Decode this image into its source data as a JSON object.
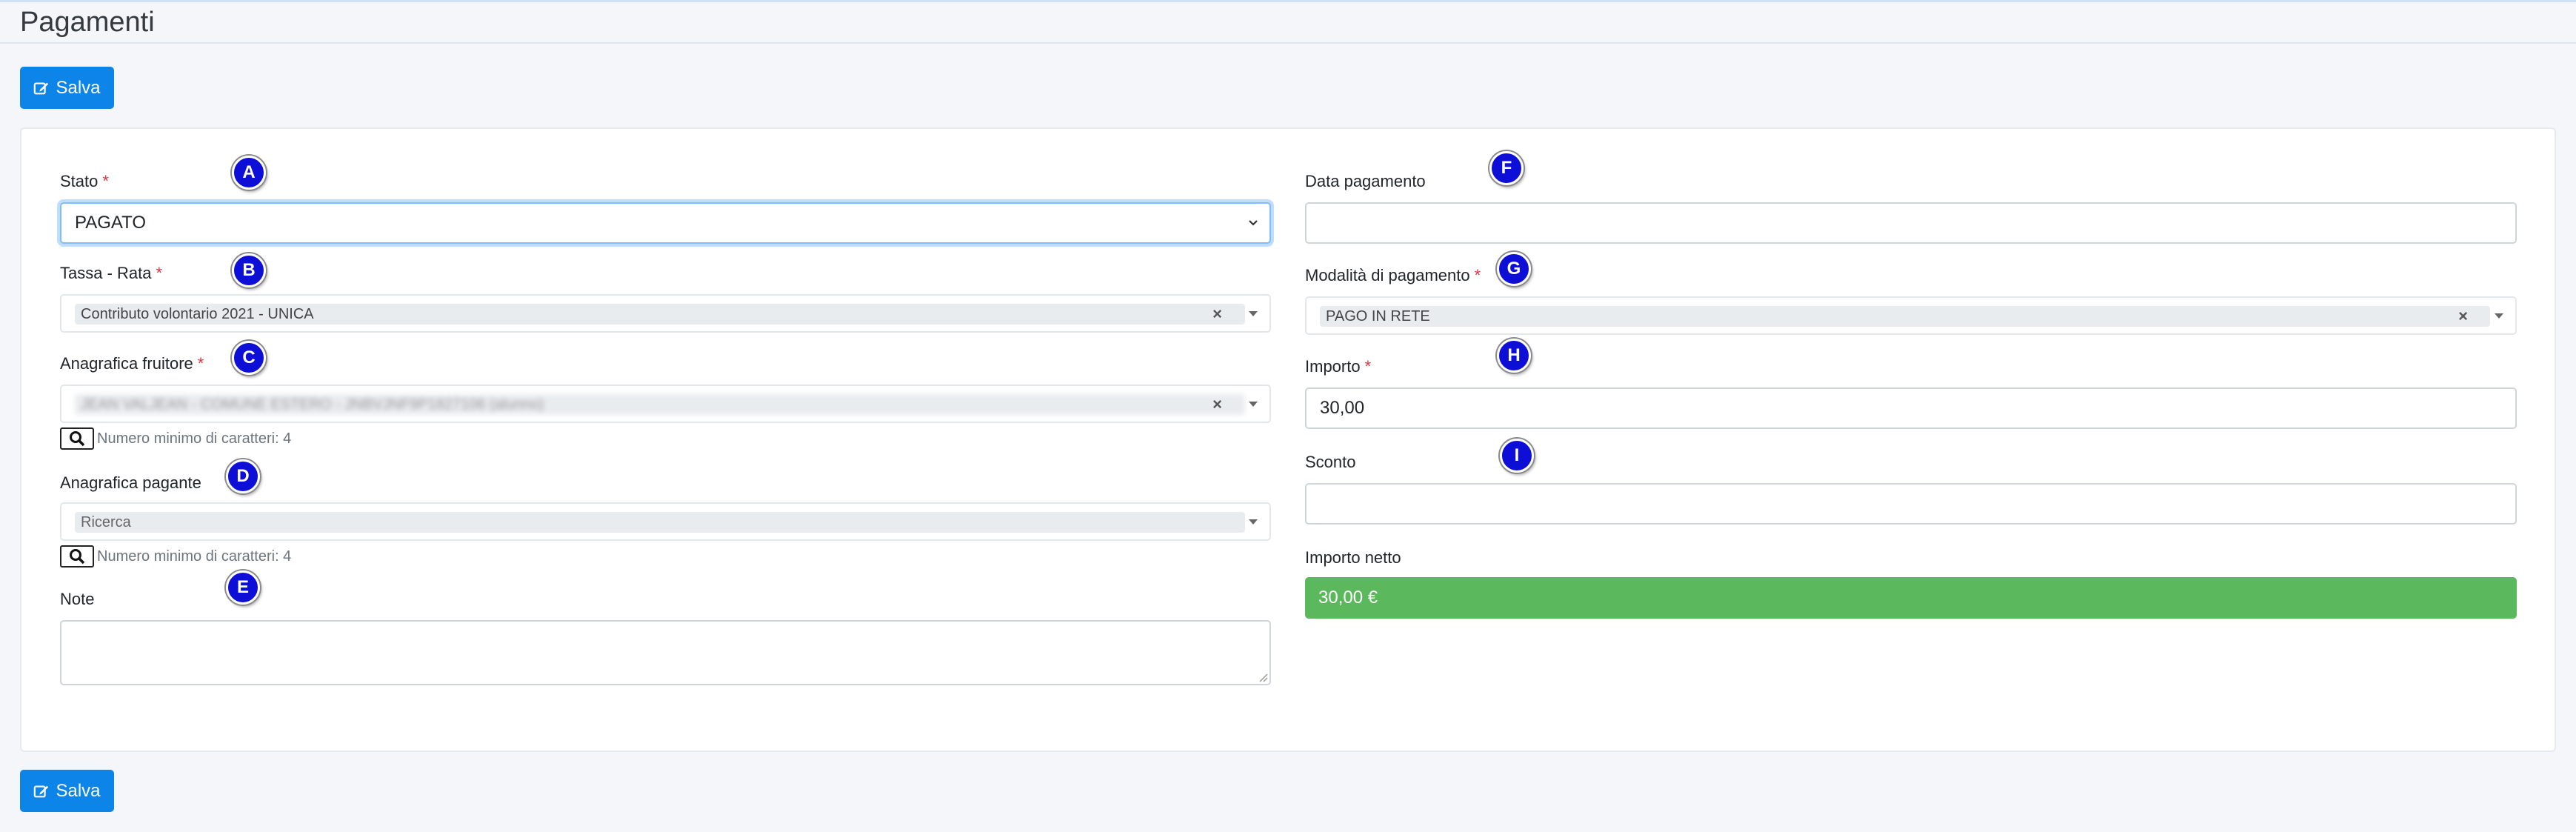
{
  "page": {
    "title": "Pagamenti"
  },
  "toolbar": {
    "save_label": "Salva"
  },
  "colors": {
    "primary": "#0d84e8",
    "success": "#5cb85c",
    "required": "#dc3545",
    "marker": "#0d0fd6"
  },
  "form": {
    "stato": {
      "label": "Stato",
      "value": "PAGATO"
    },
    "tassa_rata": {
      "label": "Tassa - Rata",
      "value": "Contributo volontario 2021 - UNICA"
    },
    "anagrafica_fruitore": {
      "label": "Anagrafica fruitore",
      "value": "JEAN VALJEAN - COMUNE ESTERO - JNBVJNF9P1827106 (alunno)",
      "hint": "Numero minimo di caratteri: 4"
    },
    "anagrafica_pagante": {
      "label": "Anagrafica pagante",
      "placeholder": "Ricerca",
      "hint": "Numero minimo di caratteri: 4"
    },
    "note": {
      "label": "Note",
      "value": ""
    },
    "data_pagamento": {
      "label": "Data pagamento",
      "value": ""
    },
    "modalita_pagamento": {
      "label": "Modalità di pagamento",
      "value": "PAGO IN RETE"
    },
    "importo": {
      "label": "Importo",
      "value": "30,00"
    },
    "sconto": {
      "label": "Sconto",
      "value": ""
    },
    "importo_netto": {
      "label": "Importo netto",
      "value": "30,00 €"
    }
  },
  "markers": [
    "A",
    "B",
    "C",
    "D",
    "E",
    "F",
    "G",
    "H",
    "I"
  ],
  "required_mark": "*",
  "clear_mark": "×"
}
